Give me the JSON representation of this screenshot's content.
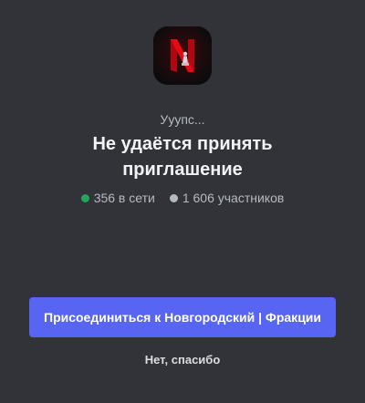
{
  "server": {
    "icon_name": "server-icon-netflix-n",
    "icon_letter": "N"
  },
  "subtitle": "Ууупс...",
  "title": {
    "line1": "Не удаётся принять",
    "line2": "приглашение"
  },
  "stats": {
    "online": "356 в сети",
    "members": "1 606 участников"
  },
  "join_button": {
    "label": "Присоединиться к Новгородский | Фракции"
  },
  "decline_link": {
    "label": "Нет, спасибо"
  },
  "colors": {
    "background": "#313338",
    "accent": "#5865f2",
    "online": "#23a55a"
  }
}
